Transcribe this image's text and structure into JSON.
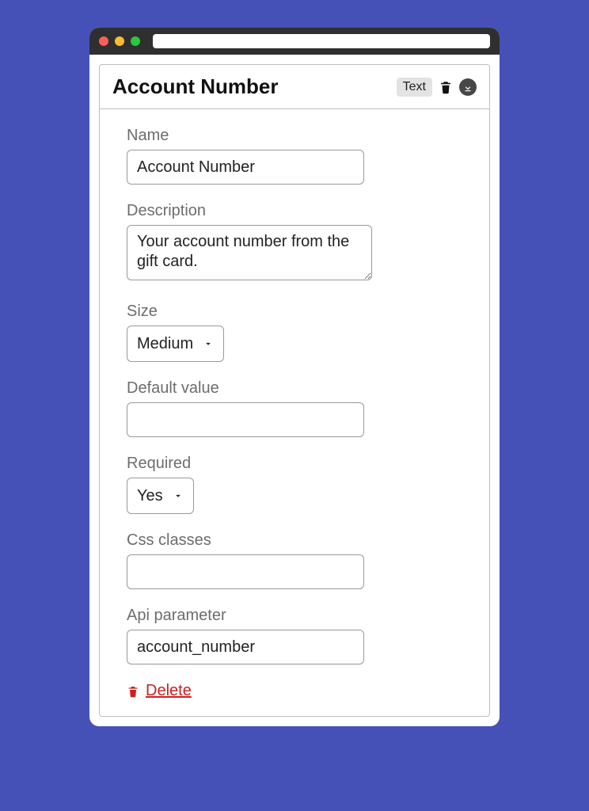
{
  "header": {
    "title": "Account Number",
    "type_badge": "Text"
  },
  "fields": {
    "name": {
      "label": "Name",
      "value": "Account Number"
    },
    "description": {
      "label": "Description",
      "value": "Your account number from the gift card."
    },
    "size": {
      "label": "Size",
      "value": "Medium"
    },
    "default_value": {
      "label": "Default value",
      "value": ""
    },
    "required": {
      "label": "Required",
      "value": "Yes"
    },
    "css_classes": {
      "label": "Css classes",
      "value": ""
    },
    "api_parameter": {
      "label": "Api parameter",
      "value": "account_number"
    }
  },
  "actions": {
    "delete": "Delete"
  }
}
